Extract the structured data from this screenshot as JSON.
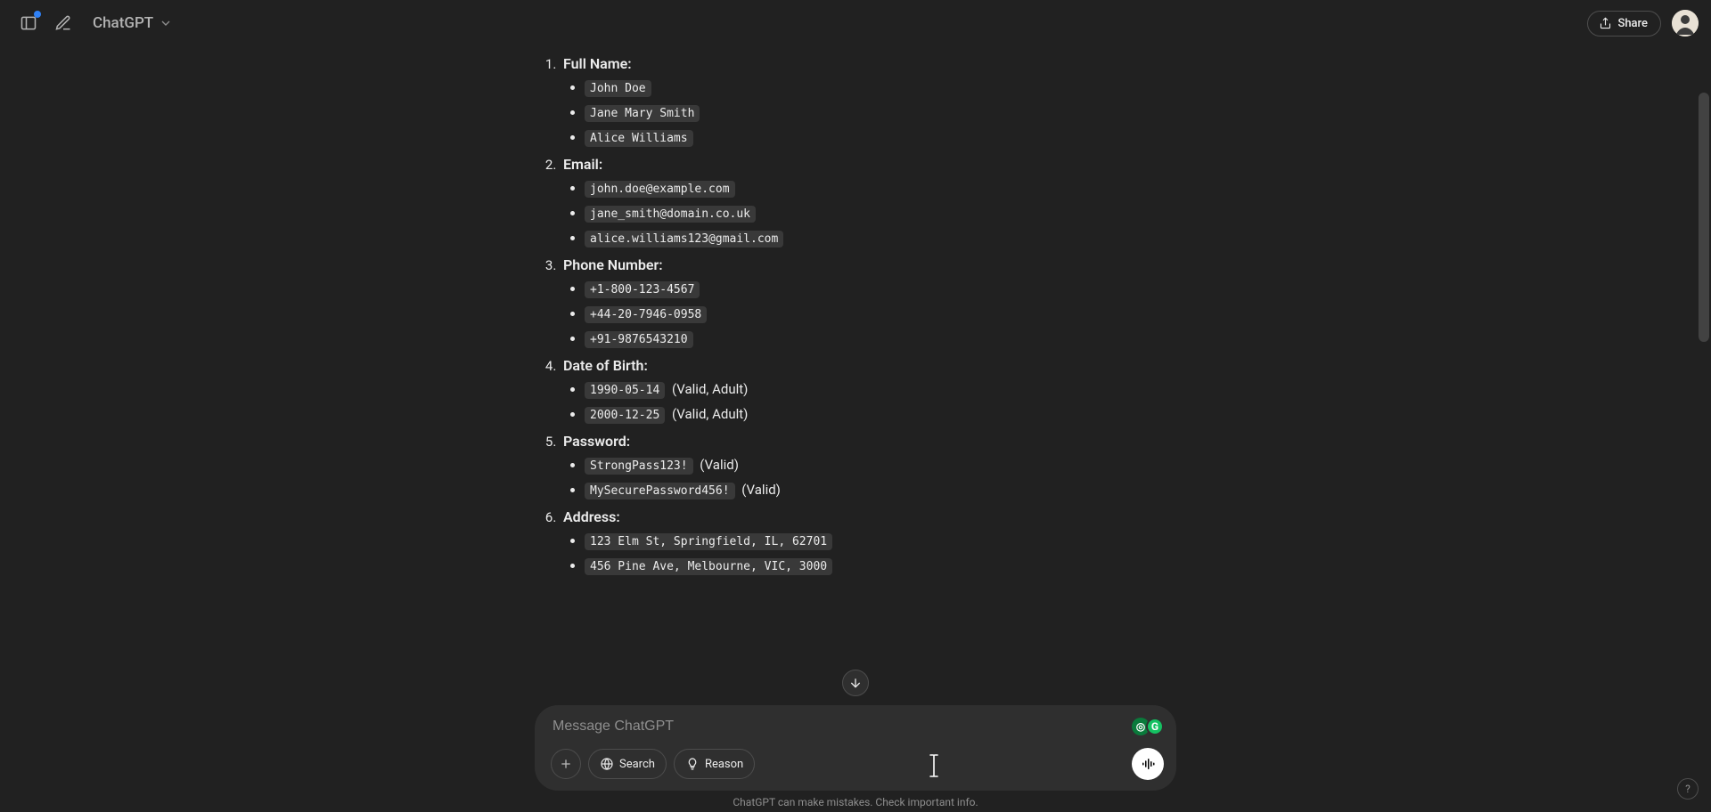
{
  "header": {
    "model_label": "ChatGPT",
    "share_label": "Share"
  },
  "composer": {
    "placeholder": "Message ChatGPT",
    "search_label": "Search",
    "reason_label": "Reason"
  },
  "disclaimer": "ChatGPT can make mistakes. Check important info.",
  "help_label": "?",
  "grammarly": {
    "badge1": "◎",
    "badge2": "G"
  },
  "list": [
    {
      "title": "Full Name:",
      "items": [
        {
          "code": "John Doe"
        },
        {
          "code": "Jane Mary Smith"
        },
        {
          "code": "Alice Williams"
        }
      ]
    },
    {
      "title": "Email:",
      "items": [
        {
          "code": "john.doe@example.com"
        },
        {
          "code": "jane_smith@domain.co.uk"
        },
        {
          "code": "alice.williams123@gmail.com"
        }
      ]
    },
    {
      "title": "Phone Number:",
      "items": [
        {
          "code": "+1-800-123-4567"
        },
        {
          "code": "+44-20-7946-0958"
        },
        {
          "code": "+91-9876543210"
        }
      ]
    },
    {
      "title": "Date of Birth:",
      "items": [
        {
          "code": "1990-05-14",
          "note": "(Valid, Adult)"
        },
        {
          "code": "2000-12-25",
          "note": "(Valid, Adult)"
        }
      ]
    },
    {
      "title": "Password:",
      "items": [
        {
          "code": "StrongPass123!",
          "note": "(Valid)"
        },
        {
          "code": "MySecurePassword456!",
          "note": "(Valid)"
        }
      ]
    },
    {
      "title": "Address:",
      "items": [
        {
          "code": "123 Elm St, Springfield, IL, 62701"
        },
        {
          "code": "456 Pine Ave, Melbourne, VIC, 3000"
        }
      ]
    }
  ]
}
